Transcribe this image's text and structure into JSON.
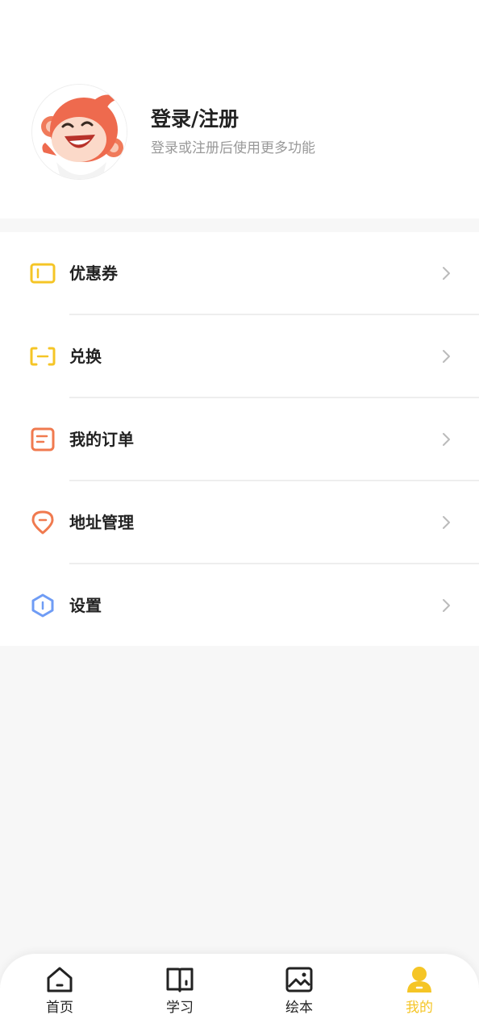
{
  "profile": {
    "title": "登录/注册",
    "subtitle": "登录或注册后使用更多功能"
  },
  "menu": {
    "items": [
      {
        "label": "优惠券",
        "icon": "coupon-icon",
        "color": "#f5c526"
      },
      {
        "label": "兑换",
        "icon": "exchange-icon",
        "color": "#f5c526"
      },
      {
        "label": "我的订单",
        "icon": "order-icon",
        "color": "#f07a4f"
      },
      {
        "label": "地址管理",
        "icon": "location-icon",
        "color": "#f07a4f"
      },
      {
        "label": "设置",
        "icon": "settings-icon",
        "color": "#6f9cf5"
      }
    ]
  },
  "tabbar": {
    "tabs": [
      {
        "label": "首页",
        "icon": "home-icon"
      },
      {
        "label": "学习",
        "icon": "book-icon"
      },
      {
        "label": "绘本",
        "icon": "picture-icon"
      },
      {
        "label": "我的",
        "icon": "user-icon",
        "active": true
      }
    ]
  },
  "colors": {
    "accent": "#f5c526",
    "background": "#f7f7f7",
    "text": "#222222",
    "muted": "#999999"
  }
}
